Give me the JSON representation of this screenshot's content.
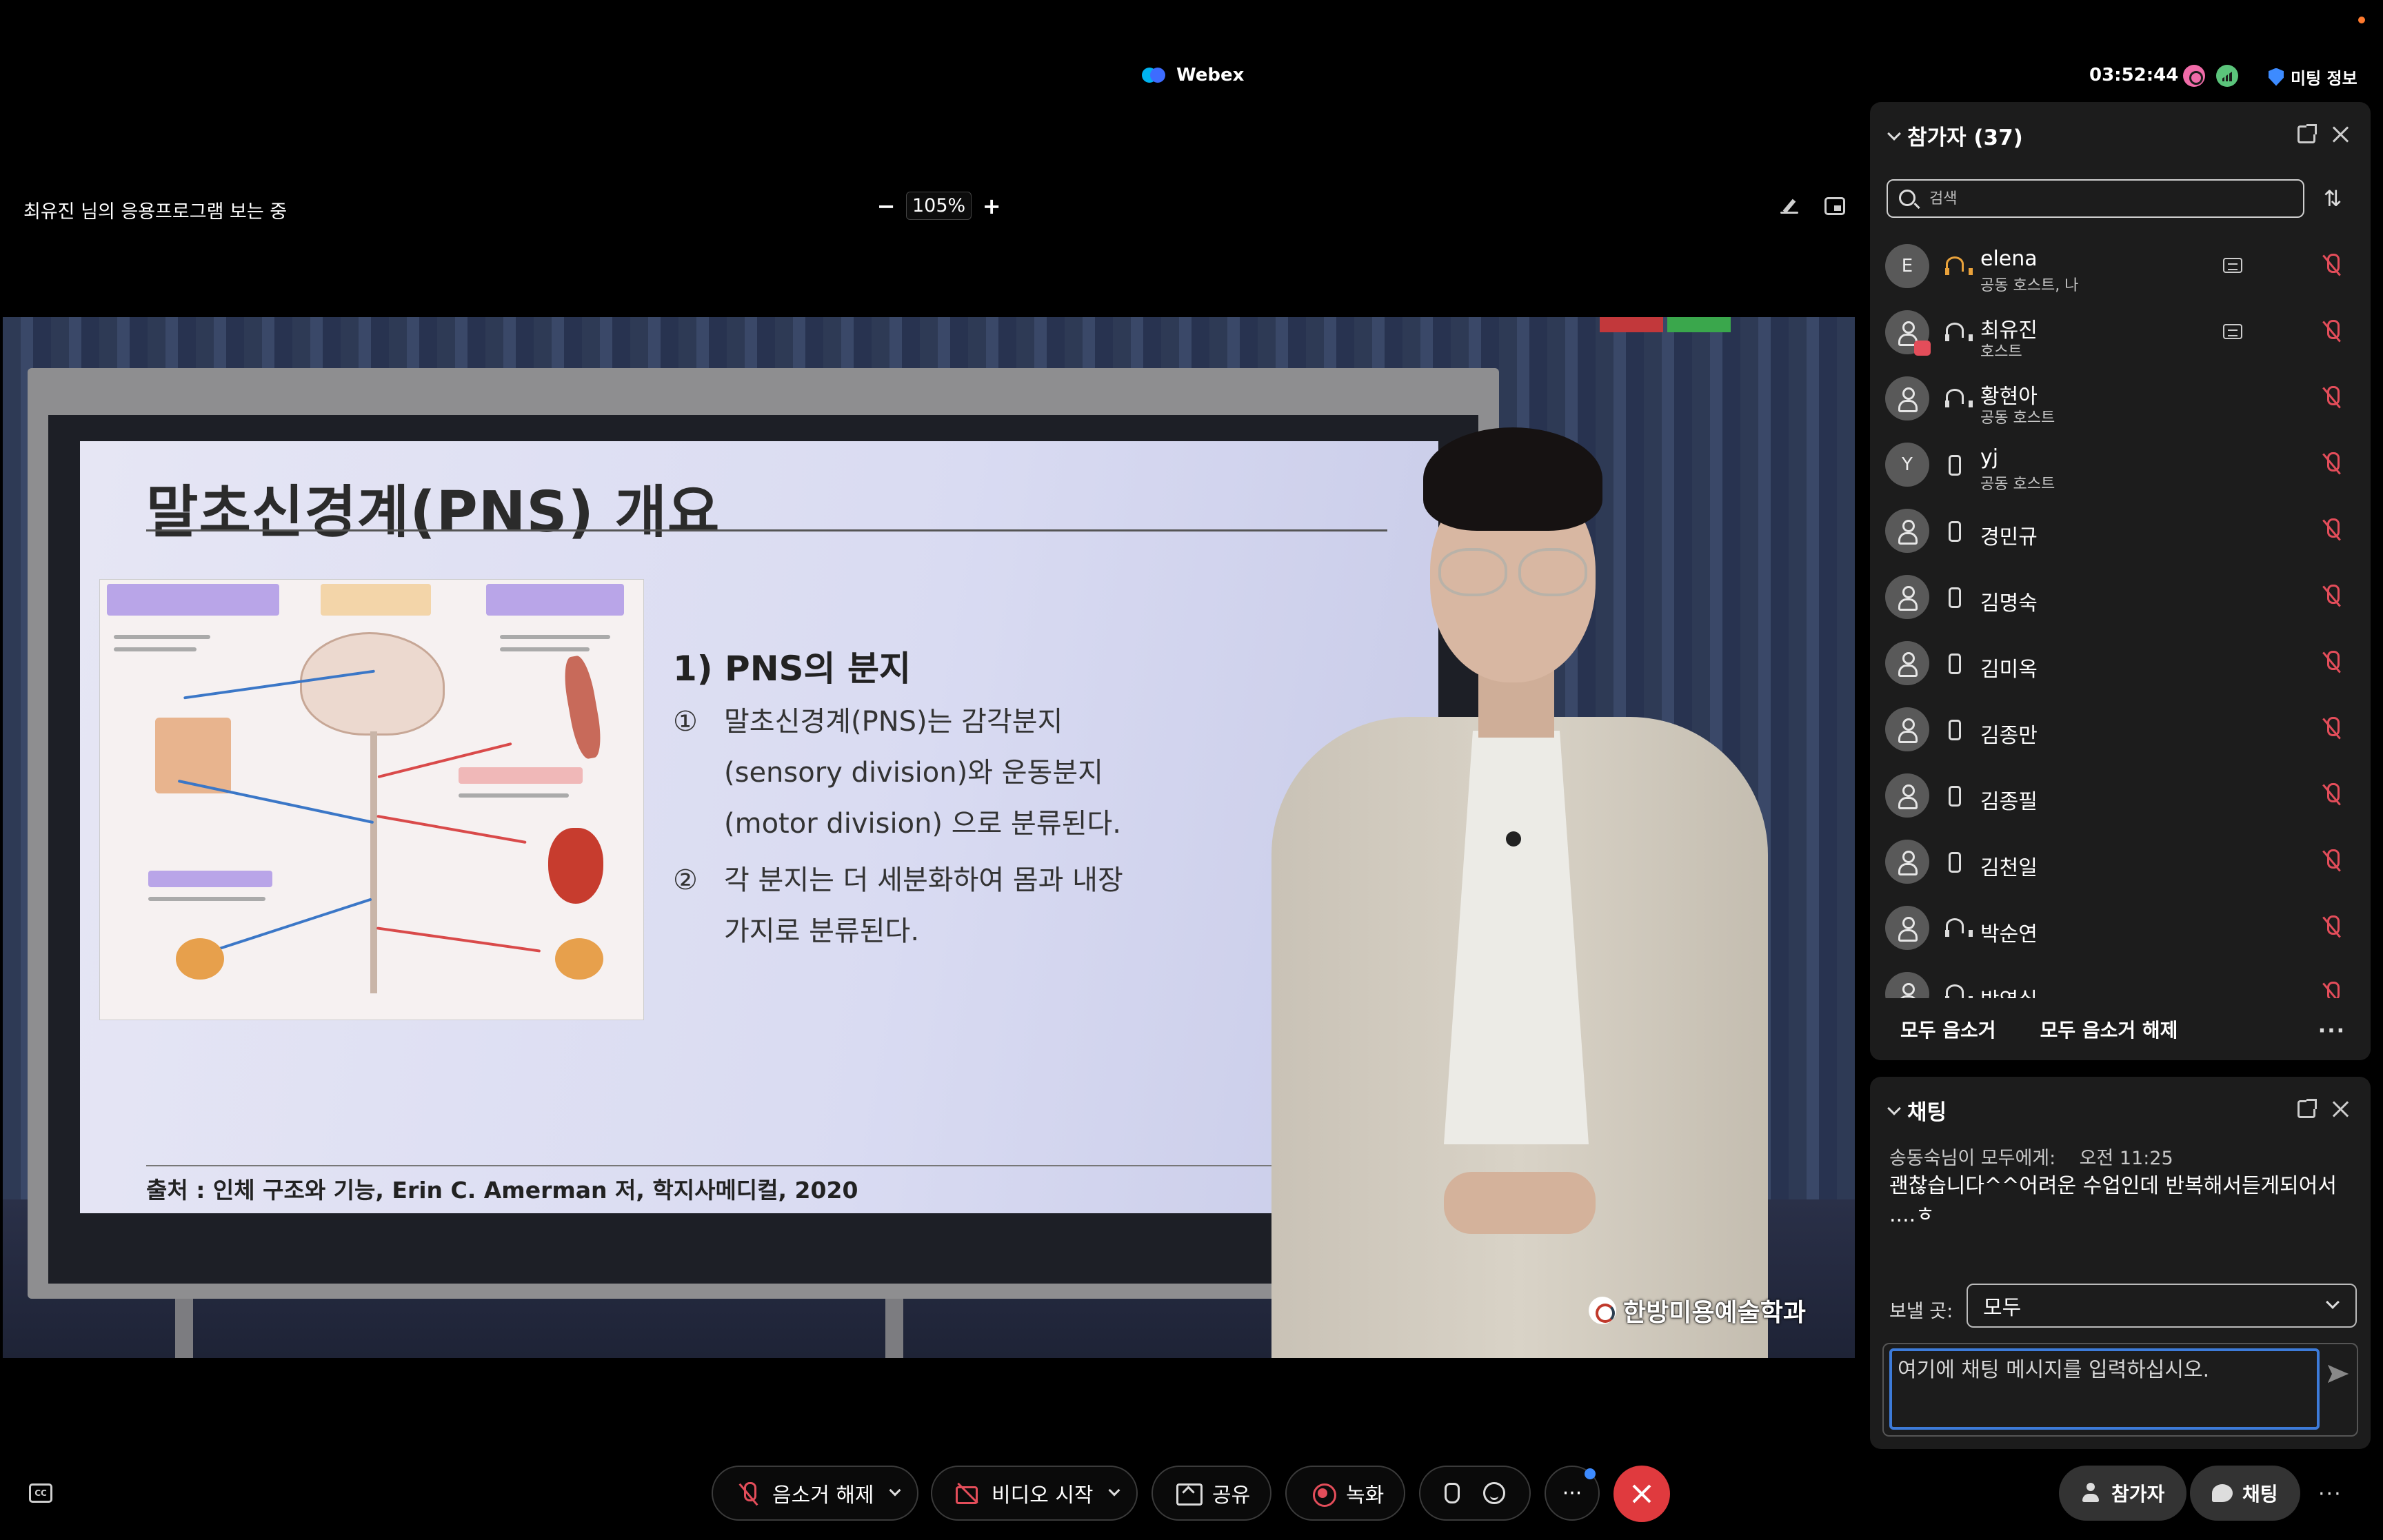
{
  "app": {
    "name": "Webex",
    "clock": "03:52:44",
    "meeting_info_label": "미팅 정보"
  },
  "viewer": {
    "viewing_label": "최유진 님의 응용프로그램 보는 중",
    "zoom_minus": "−",
    "zoom_value": "105%",
    "zoom_plus": "+"
  },
  "slide": {
    "title": "말초신경계(PNS) 개요",
    "heading": "1) PNS의 분지",
    "items": [
      {
        "num": "①",
        "lines": [
          "말초신경계(PNS)는 감각분지",
          "(sensory division)와 운동분지",
          "(motor division) 으로 분류된다."
        ]
      },
      {
        "num": "②",
        "lines": [
          "각 분지는 더 세분화하여 몸과 내장",
          "가지로 분류된다."
        ]
      }
    ],
    "source": "출처 : 인체 구조와 기능, Erin C. Amerman 저, 학지사메디컬, 2020"
  },
  "watermark": "한방미용예술학과",
  "participants": {
    "title": "참가자 (37)",
    "search_placeholder": "검색",
    "list": [
      {
        "avatar": "E",
        "name": "elena",
        "role": "공동 호스트, 나",
        "device": "headset-orange",
        "cc": true
      },
      {
        "avatar": "",
        "name": "최유진",
        "role": "호스트",
        "device": "headset",
        "cc": true,
        "badge": true
      },
      {
        "avatar": "",
        "name": "황현아",
        "role": "공동 호스트",
        "device": "headset",
        "cc": false
      },
      {
        "avatar": "Y",
        "name": "yj",
        "role": "공동 호스트",
        "device": "phone",
        "cc": false
      },
      {
        "avatar": "",
        "name": "경민규",
        "role": "",
        "device": "phone",
        "cc": false
      },
      {
        "avatar": "",
        "name": "김명숙",
        "role": "",
        "device": "phone",
        "cc": false
      },
      {
        "avatar": "",
        "name": "김미옥",
        "role": "",
        "device": "phone",
        "cc": false
      },
      {
        "avatar": "",
        "name": "김종만",
        "role": "",
        "device": "phone",
        "cc": false
      },
      {
        "avatar": "",
        "name": "김종필",
        "role": "",
        "device": "phone",
        "cc": false
      },
      {
        "avatar": "",
        "name": "김천일",
        "role": "",
        "device": "phone",
        "cc": false
      },
      {
        "avatar": "",
        "name": "박순연",
        "role": "",
        "device": "headset",
        "cc": false
      },
      {
        "avatar": "",
        "name": "박영실",
        "role": "",
        "device": "headset",
        "cc": false
      }
    ],
    "mute_all": "모두 음소거",
    "unmute_all": "모두 음소거 해제",
    "more": "···"
  },
  "chat": {
    "title": "채팅",
    "sender_line": "송동숙님이 모두에게:    오전 11:25",
    "message": "괜찮습니다^^어려운 수업인데  반복해서듣게되어서 ....ㅎ",
    "send_to_label": "보낼 곳:",
    "send_to_value": "모두",
    "input_placeholder": "여기에 채팅 메시지를 입력하십시오."
  },
  "controls": {
    "cc_label": "CC",
    "unmute": "음소거 해제",
    "start_video": "비디오 시작",
    "share": "공유",
    "record": "녹화",
    "more": "···",
    "participants_btn": "참가자",
    "chat_btn": "채팅",
    "overflow": "···"
  },
  "colors": {
    "background": "#000000",
    "panel": "#1c1c1c",
    "danger": "#e03a3e",
    "accent_blue": "#3d7bd9",
    "mute_red": "#e34d5a"
  }
}
